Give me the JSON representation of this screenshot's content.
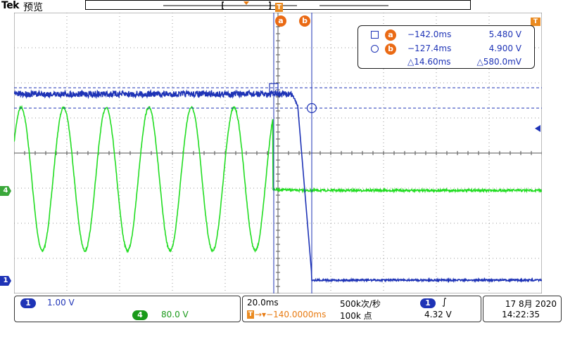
{
  "header": {
    "brand": "Tek",
    "mode": "预览"
  },
  "trigger_marker": "T",
  "cursors": {
    "a_tag": "a",
    "b_tag": "b"
  },
  "channel_markers": {
    "ch4": "4",
    "ch1": "1"
  },
  "readout": {
    "a_time": "−142.0ms",
    "a_value": "5.480 V",
    "b_time": "−127.4ms",
    "b_value": "4.900 V",
    "delta_time": "△14.60ms",
    "delta_value": "△580.0mV"
  },
  "status_bar": {
    "ch1_badge": "1",
    "ch1_scale": "1.00 V",
    "ch4_badge": "4",
    "ch4_scale": "80.0 V",
    "timebase": "20.0ms",
    "sample_rate": "500k次/秒",
    "trigger_pos": "→▾−140.0000ms",
    "record_len": "100k 点",
    "trig_ch_badge": "1",
    "trig_slope": "∫",
    "trig_level": "4.32 V",
    "date": "17 8月 2020",
    "time": "14:22:35"
  },
  "colors": {
    "ch1": "#1e33b6",
    "ch4": "#22dd22",
    "cursor": "#ea6a14"
  }
}
